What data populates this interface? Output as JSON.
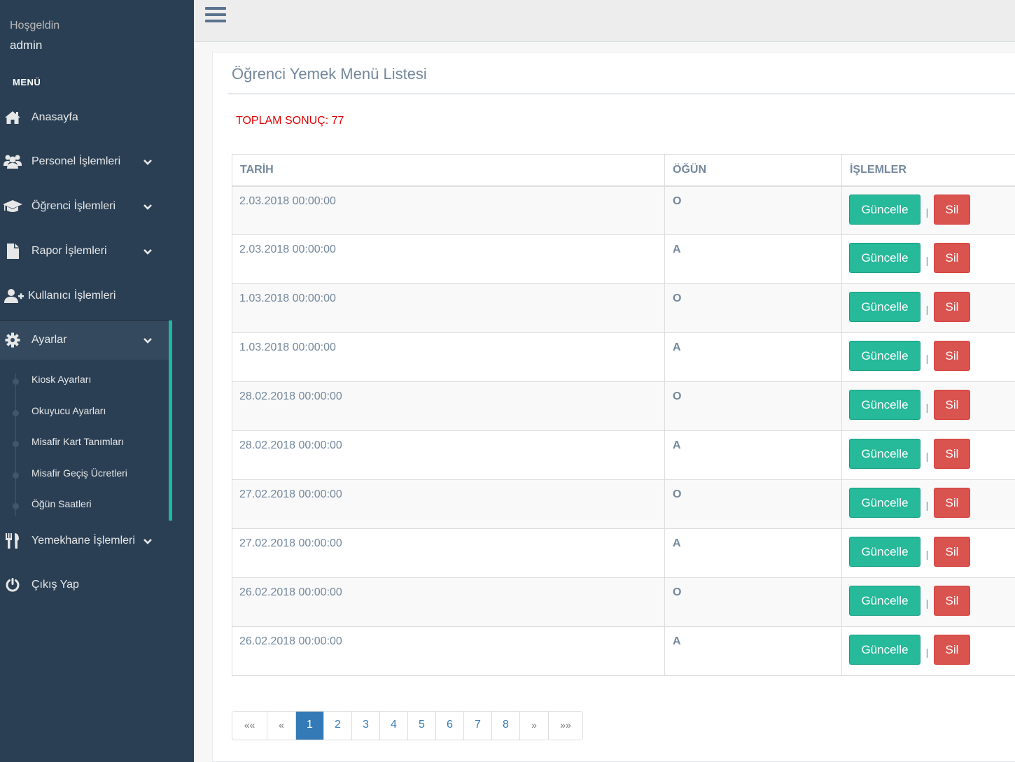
{
  "sidebar": {
    "welcome": "Hoşgeldin",
    "username": "admin",
    "menu_title": "MENÜ",
    "items": [
      {
        "label": "Anasayfa",
        "icon": "home-icon"
      },
      {
        "label": "Personel İşlemleri",
        "icon": "users-icon"
      },
      {
        "label": "Öğrenci İşlemleri",
        "icon": "graduation-cap-icon"
      },
      {
        "label": "Rapor İşlemleri",
        "icon": "file-icon"
      },
      {
        "label": "Kullanıcı İşlemleri",
        "icon": "user-plus-icon"
      },
      {
        "label": "Ayarlar",
        "icon": "gear-icon"
      },
      {
        "label": "Yemekhane İşlemleri",
        "icon": "cutlery-icon"
      },
      {
        "label": "Çıkış Yap",
        "icon": "power-icon"
      }
    ],
    "submenu": [
      "Kiosk Ayarları",
      "Okuyucu Ayarları",
      "Misafir Kart Tanımları",
      "Misafir Geçiş Ücretleri",
      "Öğün Saatleri"
    ]
  },
  "panel": {
    "title": "Öğrenci Yemek Menü Listesi",
    "total": "TOPLAM SONUÇ: 77"
  },
  "table": {
    "headers": [
      "TARİH",
      "ÖĞÜN",
      "İŞLEMLER"
    ],
    "rows": [
      {
        "date": "2.03.2018 00:00:00",
        "meal": "O"
      },
      {
        "date": "2.03.2018 00:00:00",
        "meal": "A"
      },
      {
        "date": "1.03.2018 00:00:00",
        "meal": "O"
      },
      {
        "date": "1.03.2018 00:00:00",
        "meal": "A"
      },
      {
        "date": "28.02.2018 00:00:00",
        "meal": "O"
      },
      {
        "date": "28.02.2018 00:00:00",
        "meal": "A"
      },
      {
        "date": "27.02.2018 00:00:00",
        "meal": "O"
      },
      {
        "date": "27.02.2018 00:00:00",
        "meal": "A"
      },
      {
        "date": "26.02.2018 00:00:00",
        "meal": "O"
      },
      {
        "date": "26.02.2018 00:00:00",
        "meal": "A"
      }
    ],
    "update_label": "Güncelle",
    "delete_label": "Sil",
    "separator": "|"
  },
  "pagination": {
    "first": "««",
    "prev": "«",
    "pages": [
      "1",
      "2",
      "3",
      "4",
      "5",
      "6",
      "7",
      "8"
    ],
    "next": "»",
    "last": "»»",
    "active": "1"
  },
  "colors": {
    "sidebar_bg": "#2a3f54",
    "accent": "#1abb9c",
    "update_button": "#26b99a",
    "delete_button": "#d9534f",
    "total_text": "#e00000",
    "page_active": "#337ab7"
  }
}
